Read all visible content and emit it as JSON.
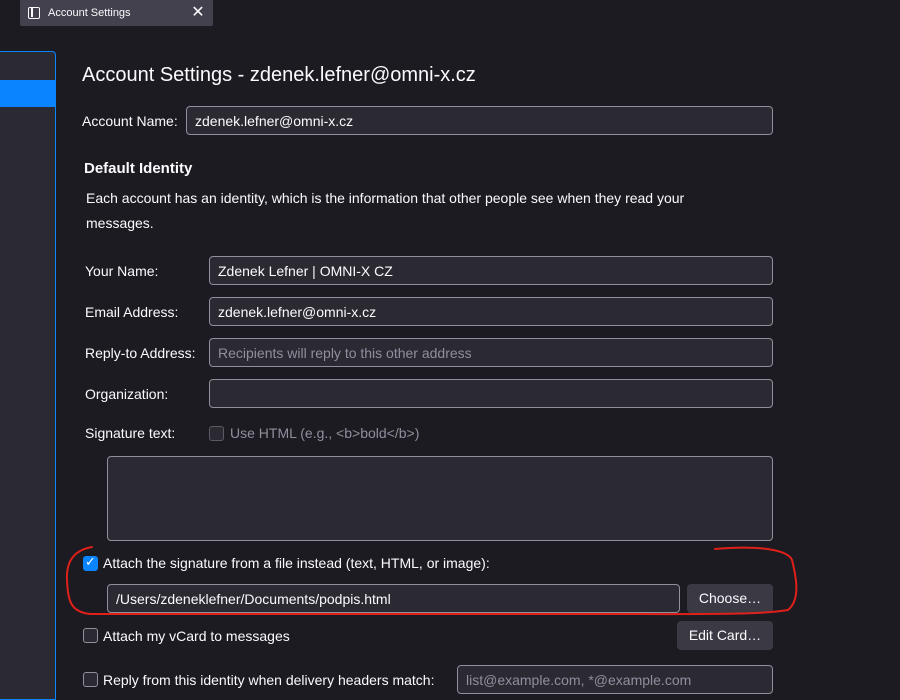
{
  "tab": {
    "title": "Account Settings",
    "close_glyph": "✕"
  },
  "page": {
    "title": "Account Settings - zdenek.lefner@omni-x.cz",
    "account_name_label": "Account Name:",
    "account_name_value": "zdenek.lefner@omni-x.cz"
  },
  "identity": {
    "section_title": "Default Identity",
    "description": "Each account has an identity, which is the information that other people see when they read your messages.",
    "your_name_label": "Your Name:",
    "your_name_value": "Zdenek Lefner | OMNI-X CZ",
    "email_label": "Email Address:",
    "email_value": "zdenek.lefner@omni-x.cz",
    "reply_to_label": "Reply-to Address:",
    "reply_to_placeholder": "Recipients will reply to this other address",
    "organization_label": "Organization:",
    "organization_value": "",
    "signature_label": "Signature text:",
    "use_html_label": "Use HTML (e.g., <b>bold</b>)",
    "use_html_checked": false,
    "signature_text": ""
  },
  "signature_file": {
    "checkbox_label": "Attach the signature from a file instead (text, HTML, or image):",
    "checked": true,
    "path_value": "/Users/zdeneklefner/Documents/podpis.html",
    "choose_button": "Choose…"
  },
  "vcard": {
    "checkbox_label": "Attach my vCard to messages",
    "checked": false,
    "edit_button": "Edit Card…"
  },
  "reply_identity": {
    "checkbox_label": "Reply from this identity when delivery headers match:",
    "checked": false,
    "placeholder": "list@example.com, *@example.com"
  },
  "colors": {
    "background": "#1c1b22",
    "field_bg": "#2b2a33",
    "accent": "#0a84ff",
    "annotation_red": "#e0201a"
  },
  "icons": {
    "tab": "sidebar-panel-icon",
    "close": "close-icon",
    "check": "checkmark-icon"
  }
}
